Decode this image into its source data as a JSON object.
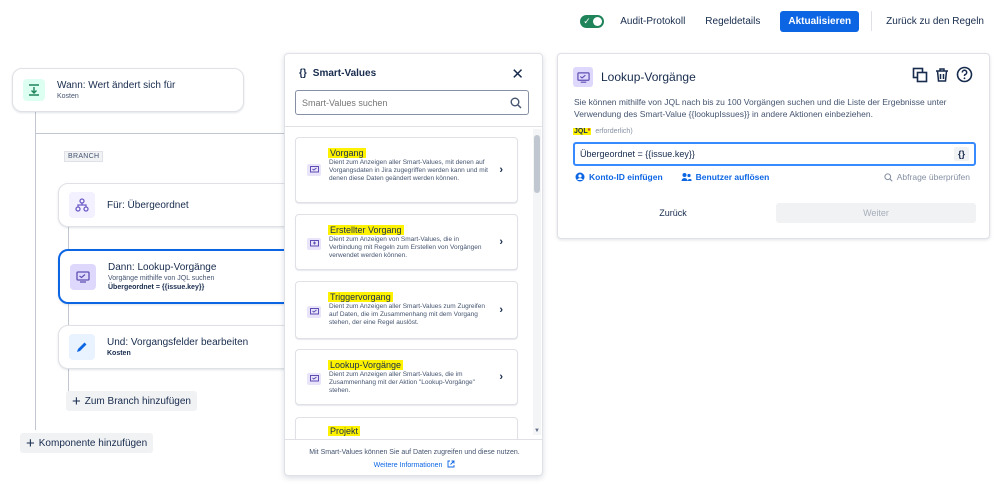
{
  "topbar": {
    "audit_label": "Audit-Protokoll",
    "details_label": "Regeldetails",
    "update_label": "Aktualisieren",
    "back_label": "Zurück zu den Regeln",
    "toggle_check": "✓"
  },
  "rule": {
    "trigger": {
      "title": "Wann: Wert ändert sich für",
      "subtitle": "Kosten"
    },
    "branch_label": "BRANCH",
    "branch_node": {
      "title": "Für: Übergeordnet"
    },
    "lookup_node": {
      "title": "Dann: Lookup-Vorgänge",
      "subtitle": "Vorgänge mithilfe von JQL suchen",
      "detail": "Übergeordnet = {{issue.key}}"
    },
    "edit_node": {
      "title": "Und: Vorgangsfelder bearbeiten",
      "subtitle": "Kosten"
    },
    "add_branch_label": "Zum Branch hinzufügen",
    "add_component_label": "Komponente hinzufügen"
  },
  "smart_values": {
    "braces": "{}",
    "title": "Smart-Values",
    "close": "✕",
    "search_placeholder": "Smart-Values suchen",
    "items": [
      {
        "title": "Vorgang",
        "description": "Dient zum Anzeigen aller Smart-Values, mit denen auf Vorgangsdaten in Jira zugegriffen werden kann und mit denen diese Daten geändert werden können."
      },
      {
        "title": "Erstellter Vorgang",
        "description": "Dient zum Anzeigen von Smart-Values, die in Verbindung mit Regeln zum Erstellen von Vorgängen verwendet werden können."
      },
      {
        "title": "Triggervorgang",
        "description": "Dient zum Anzeigen aller Smart-Values zum Zugreifen auf Daten, die im Zusammenhang mit dem Vorgang stehen, der eine Regel auslöst."
      },
      {
        "title": "Lookup-Vorgänge",
        "description": "Dient zum Anzeigen aller Smart-Values, die im Zusammenhang mit der Aktion \"Lookup-Vorgänge\" stehen."
      },
      {
        "title": "Projekt",
        "description": ""
      }
    ],
    "footer_text": "Mit Smart-Values können Sie auf Daten zugreifen und diese nutzen.",
    "footer_link": "Weitere Informationen"
  },
  "lookup": {
    "title": "Lookup-Vorgänge",
    "description": "Sie können mithilfe von JQL nach bis zu 100 Vorgängen suchen und die Liste der Ergebnisse unter Verwendung des Smart-Value {{lookupIssues}} in andere Aktionen einbeziehen.",
    "jql_label": "JQL",
    "required_mark": "*",
    "required_hint": "erforderlich)",
    "jql_value": "Übergeordnet = {{issue.key}}",
    "braces": "{}",
    "account_link": "Konto-ID einfügen",
    "users_link": "Benutzer auflösen",
    "validate_link": "Abfrage überprüfen",
    "back_label": "Zurück",
    "next_label": "Weiter"
  },
  "colors": {
    "accent": "#0c66e4",
    "toggle": "#1f845a",
    "highlight": "#fff200"
  }
}
